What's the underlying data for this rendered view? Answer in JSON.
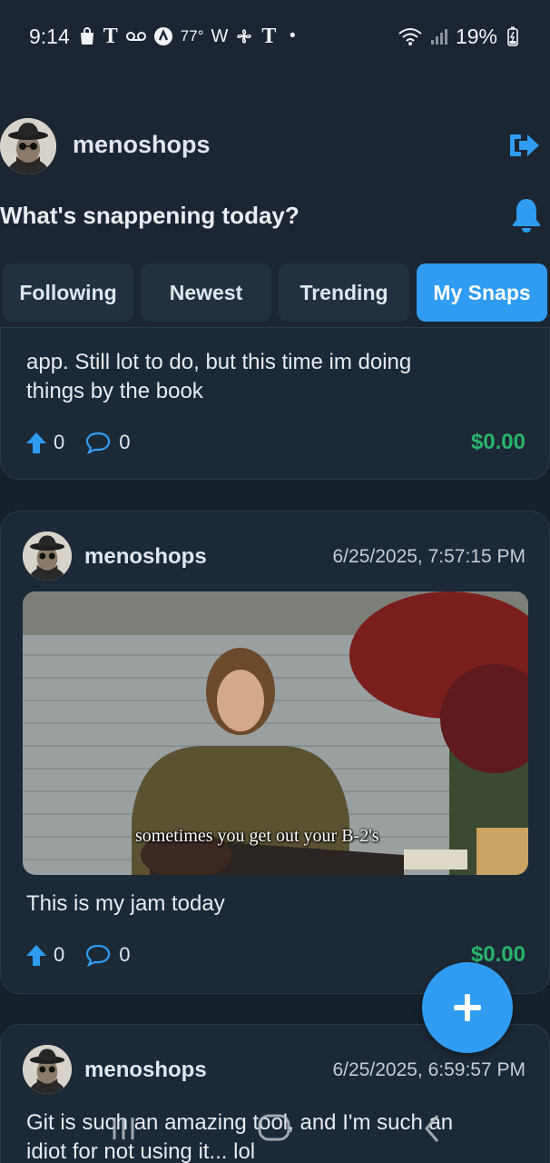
{
  "status_bar": {
    "time": "9:14",
    "temperature": "77°",
    "battery": "19%"
  },
  "header": {
    "username": "menoshops",
    "prompt": "What's snappening today?",
    "tabs": [
      {
        "label": "Following",
        "active": false
      },
      {
        "label": "Newest",
        "active": false
      },
      {
        "label": "Trending",
        "active": false
      },
      {
        "label": "My Snaps",
        "active": true
      }
    ]
  },
  "posts": [
    {
      "text_line1": "app. Still lot to do, but this time im doing",
      "text_line2": "things by the book",
      "upvotes": "0",
      "comments": "0",
      "amount": "$0.00"
    },
    {
      "username": "menoshops",
      "timestamp": "6/25/2025, 7:57:15 PM",
      "media_caption": "sometimes you get out your B-2's",
      "text": "This is my jam today",
      "upvotes": "0",
      "comments": "0",
      "amount": "$0.00"
    },
    {
      "username": "menoshops",
      "timestamp": "6/25/2025, 6:59:57 PM",
      "text_line1": "Git is such an amazing tool, and I'm such an",
      "text_line2": "idiot for not using it... lol"
    }
  ],
  "colors": {
    "accent": "#2f9cf2",
    "money": "#29b36a",
    "background": "#17212b",
    "card": "#1c2936"
  },
  "icons": {
    "logout": "logout-icon",
    "notifications": "bell-icon",
    "upvote": "arrow-up-icon",
    "comment": "comment-bubble-icon",
    "compose": "plus-icon"
  }
}
